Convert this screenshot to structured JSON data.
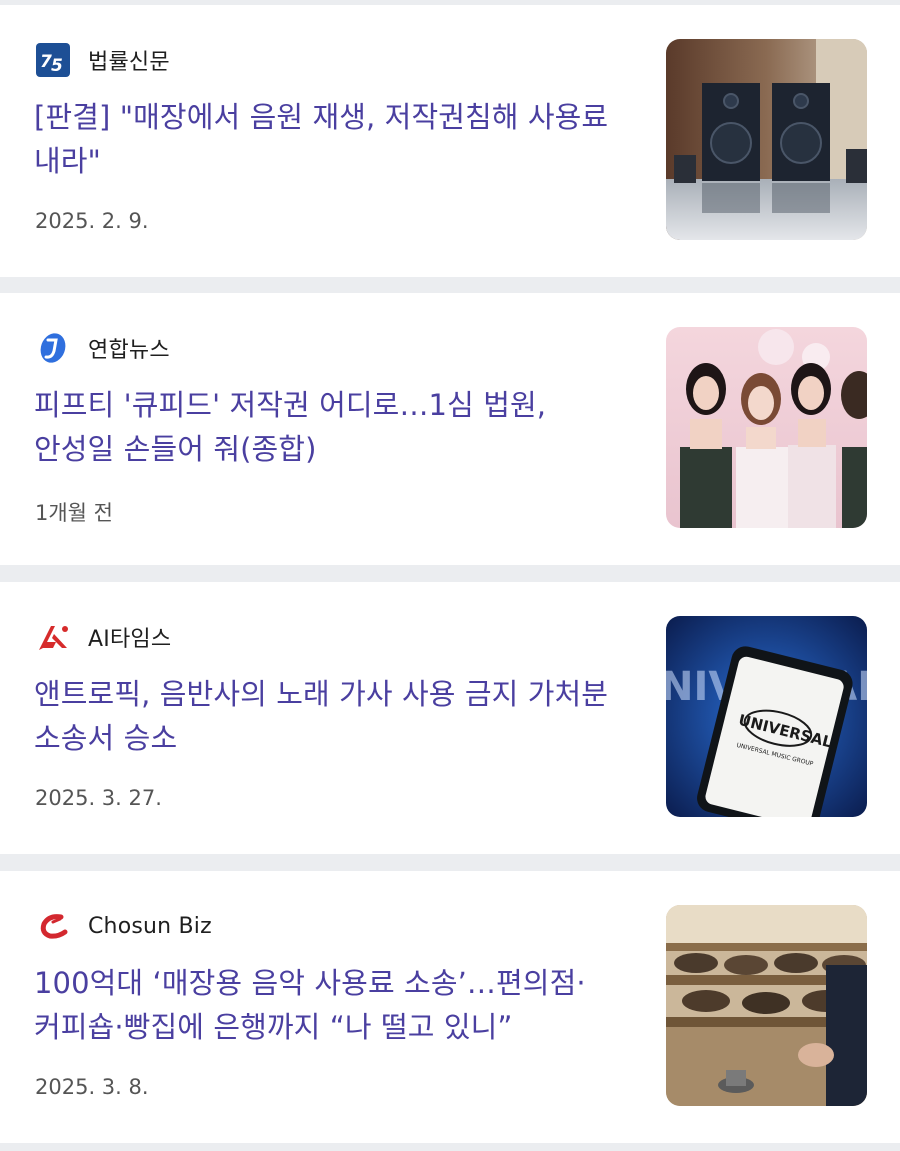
{
  "articles": [
    {
      "source": "법률신문",
      "logo_icon": "law-times-logo-icon",
      "title": "[판결] \"매장에서 음원 재생, 저작권침해 사용료 내라\"",
      "date": "2025. 2. 9.",
      "thumbnail": "speakers-photo"
    },
    {
      "source": "연합뉴스",
      "logo_icon": "yonhap-logo-icon",
      "title": "피프티 '큐피드' 저작권 어디로…1심 법원, 안성일 손들어 줘(종합)",
      "date": "1개월 전",
      "thumbnail": "girl-group-photo"
    },
    {
      "source": "AI타임스",
      "logo_icon": "ai-times-logo-icon",
      "title": "앤트로픽, 음반사의 노래 가사 사용 금지 가처분 소송서 승소",
      "date": "2025. 3. 27.",
      "thumbnail": "universal-phone-photo"
    },
    {
      "source": "Chosun Biz",
      "logo_icon": "chosun-biz-logo-icon",
      "title": "100억대 ‘매장용 음악 사용료 소송’…편의점·커피숍·빵집에 은행까지 “나 떨고 있니”",
      "date": "2025. 3. 8.",
      "thumbnail": "bakery-shelf-photo"
    }
  ],
  "colors": {
    "headline": "#4a3fa0",
    "separator": "#ebedf0",
    "meta": "#555555"
  }
}
